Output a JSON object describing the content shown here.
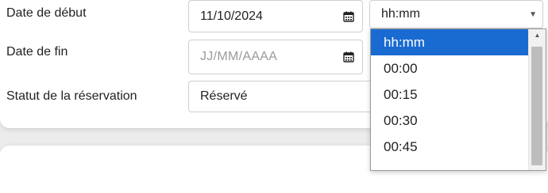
{
  "form": {
    "start_date": {
      "label": "Date de début",
      "value": "11/10/2024",
      "icon": "calendar-icon"
    },
    "end_date": {
      "label": "Date de fin",
      "placeholder": "JJ/MM/AAAA",
      "icon": "calendar-icon"
    },
    "status": {
      "label": "Statut de la réservation",
      "value": "Réservé"
    },
    "start_time": {
      "value": "hh:mm"
    }
  },
  "dropdown": {
    "options": [
      "hh:mm",
      "00:00",
      "00:15",
      "00:30",
      "00:45"
    ],
    "selected_index": 0
  },
  "colors": {
    "selected_option": "#1a6bd1",
    "background": "#ececec",
    "card": "#ffffff"
  }
}
